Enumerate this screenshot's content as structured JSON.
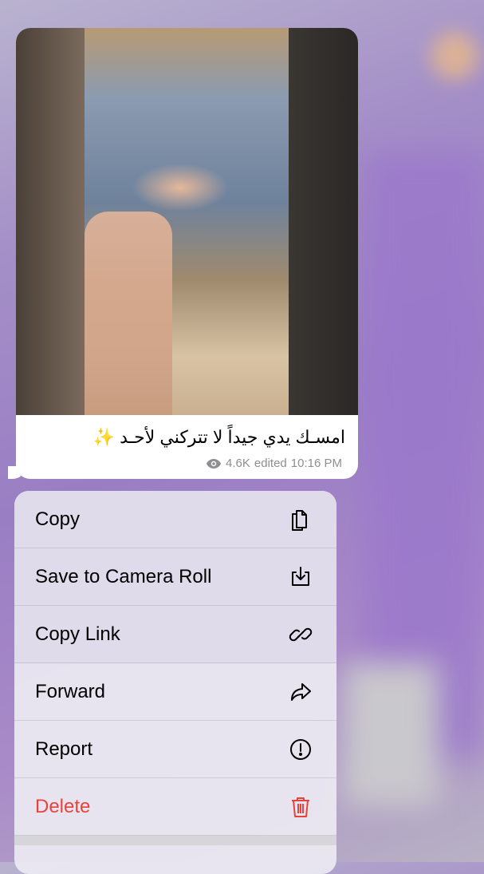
{
  "message": {
    "caption": "امسـك يدي جيداً  لا تتركني لأحـد ✨",
    "views": "4.6K",
    "status": "edited",
    "time": "10:16 PM",
    "view_icon": "eye-icon"
  },
  "menu": {
    "items": [
      {
        "label": "Copy",
        "icon": "copy-icon"
      },
      {
        "label": "Save to Camera Roll",
        "icon": "download-icon"
      },
      {
        "label": "Copy Link",
        "icon": "link-icon"
      },
      {
        "label": "Forward",
        "icon": "forward-icon"
      },
      {
        "label": "Report",
        "icon": "exclamation-circle-icon"
      },
      {
        "label": "Delete",
        "icon": "trash-icon",
        "color": "#e8433a"
      }
    ]
  }
}
